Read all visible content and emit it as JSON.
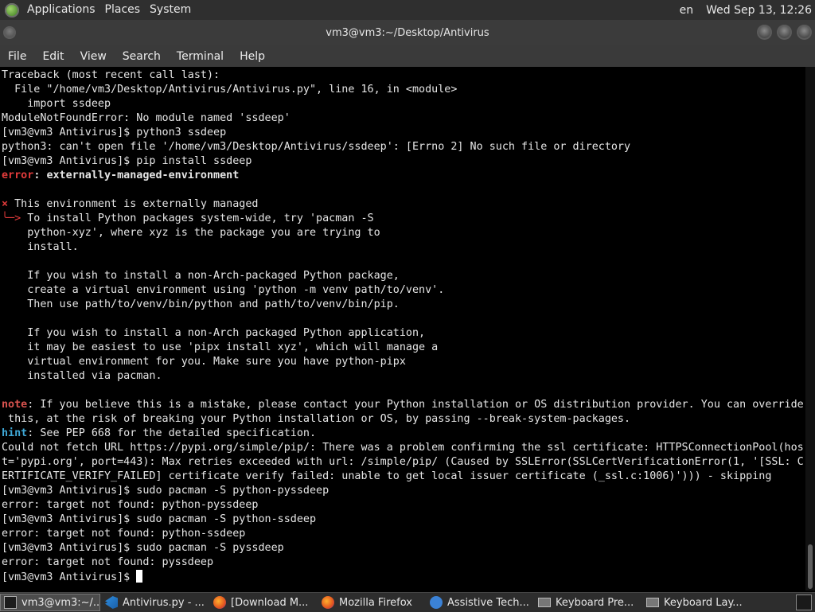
{
  "top_panel": {
    "menus": [
      "Applications",
      "Places",
      "System"
    ],
    "keyboard_layout": "en",
    "clock": "Wed Sep 13, 12:26"
  },
  "window": {
    "title": "vm3@vm3:~/Desktop/Antivirus"
  },
  "menu_bar": [
    "File",
    "Edit",
    "View",
    "Search",
    "Terminal",
    "Help"
  ],
  "terminal": {
    "lines": [
      "Traceback (most recent call last):",
      "  File \"/home/vm3/Desktop/Antivirus/Antivirus.py\", line 16, in <module>",
      "    import ssdeep",
      "ModuleNotFoundError: No module named 'ssdeep'",
      "[vm3@vm3 Antivirus]$ python3 ssdeep",
      "python3: can't open file '/home/vm3/Desktop/Antivirus/ssdeep': [Errno 2] No such file or directory",
      "[vm3@vm3 Antivirus]$ pip install ssdeep"
    ],
    "error_prefix": "error",
    "error_text": "externally-managed-environment",
    "managed_marker": "×",
    "managed_title": " This environment is externally managed",
    "managed_arrow": "╰─>",
    "managed_lines": [
      " To install Python packages system-wide, try 'pacman -S",
      "    python-xyz', where xyz is the package you are trying to",
      "    install.",
      "",
      "    If you wish to install a non-Arch-packaged Python package,",
      "    create a virtual environment using 'python -m venv path/to/venv'.",
      "    Then use path/to/venv/bin/python and path/to/venv/bin/pip.",
      "",
      "    If you wish to install a non-Arch packaged Python application,",
      "    it may be easiest to use 'pipx install xyz', which will manage a",
      "    virtual environment for you. Make sure you have python-pipx",
      "    installed via pacman."
    ],
    "note_prefix": "note",
    "note_line1": ": If you believe this is a mistake, please contact your Python installation or OS distribution provider. You can override",
    "note_line2": " this, at the risk of breaking your Python installation or OS, by passing --break-system-packages.",
    "hint_prefix": "hint",
    "hint_text": ": See PEP 668 for the detailed specification.",
    "tail_lines": [
      "Could not fetch URL https://pypi.org/simple/pip/: There was a problem confirming the ssl certificate: HTTPSConnectionPool(hos",
      "t='pypi.org', port=443): Max retries exceeded with url: /simple/pip/ (Caused by SSLError(SSLCertVerificationError(1, '[SSL: C",
      "ERTIFICATE_VERIFY_FAILED] certificate verify failed: unable to get local issuer certificate (_ssl.c:1006)'))) - skipping",
      "[vm3@vm3 Antivirus]$ sudo pacman -S python-pyssdeep",
      "error: target not found: python-pyssdeep",
      "[vm3@vm3 Antivirus]$ sudo pacman -S python-ssdeep",
      "error: target not found: python-ssdeep",
      "[vm3@vm3 Antivirus]$ sudo pacman -S pyssdeep",
      "error: target not found: pyssdeep"
    ],
    "prompt": "[vm3@vm3 Antivirus]$ "
  },
  "taskbar": {
    "tasks": [
      {
        "label": "vm3@vm3:~/...",
        "icon": "terminal-icon",
        "active": true
      },
      {
        "label": "Antivirus.py - ...",
        "icon": "vscode-icon",
        "active": false
      },
      {
        "label": "[Download M...",
        "icon": "firefox-icon",
        "active": false
      },
      {
        "label": "Mozilla Firefox",
        "icon": "firefox-icon",
        "active": false
      },
      {
        "label": "Assistive Tech...",
        "icon": "accessibility-icon",
        "active": false
      },
      {
        "label": "Keyboard Pre...",
        "icon": "keyboard-icon",
        "active": false
      },
      {
        "label": "Keyboard Lay...",
        "icon": "keyboard-icon",
        "active": false
      }
    ]
  }
}
